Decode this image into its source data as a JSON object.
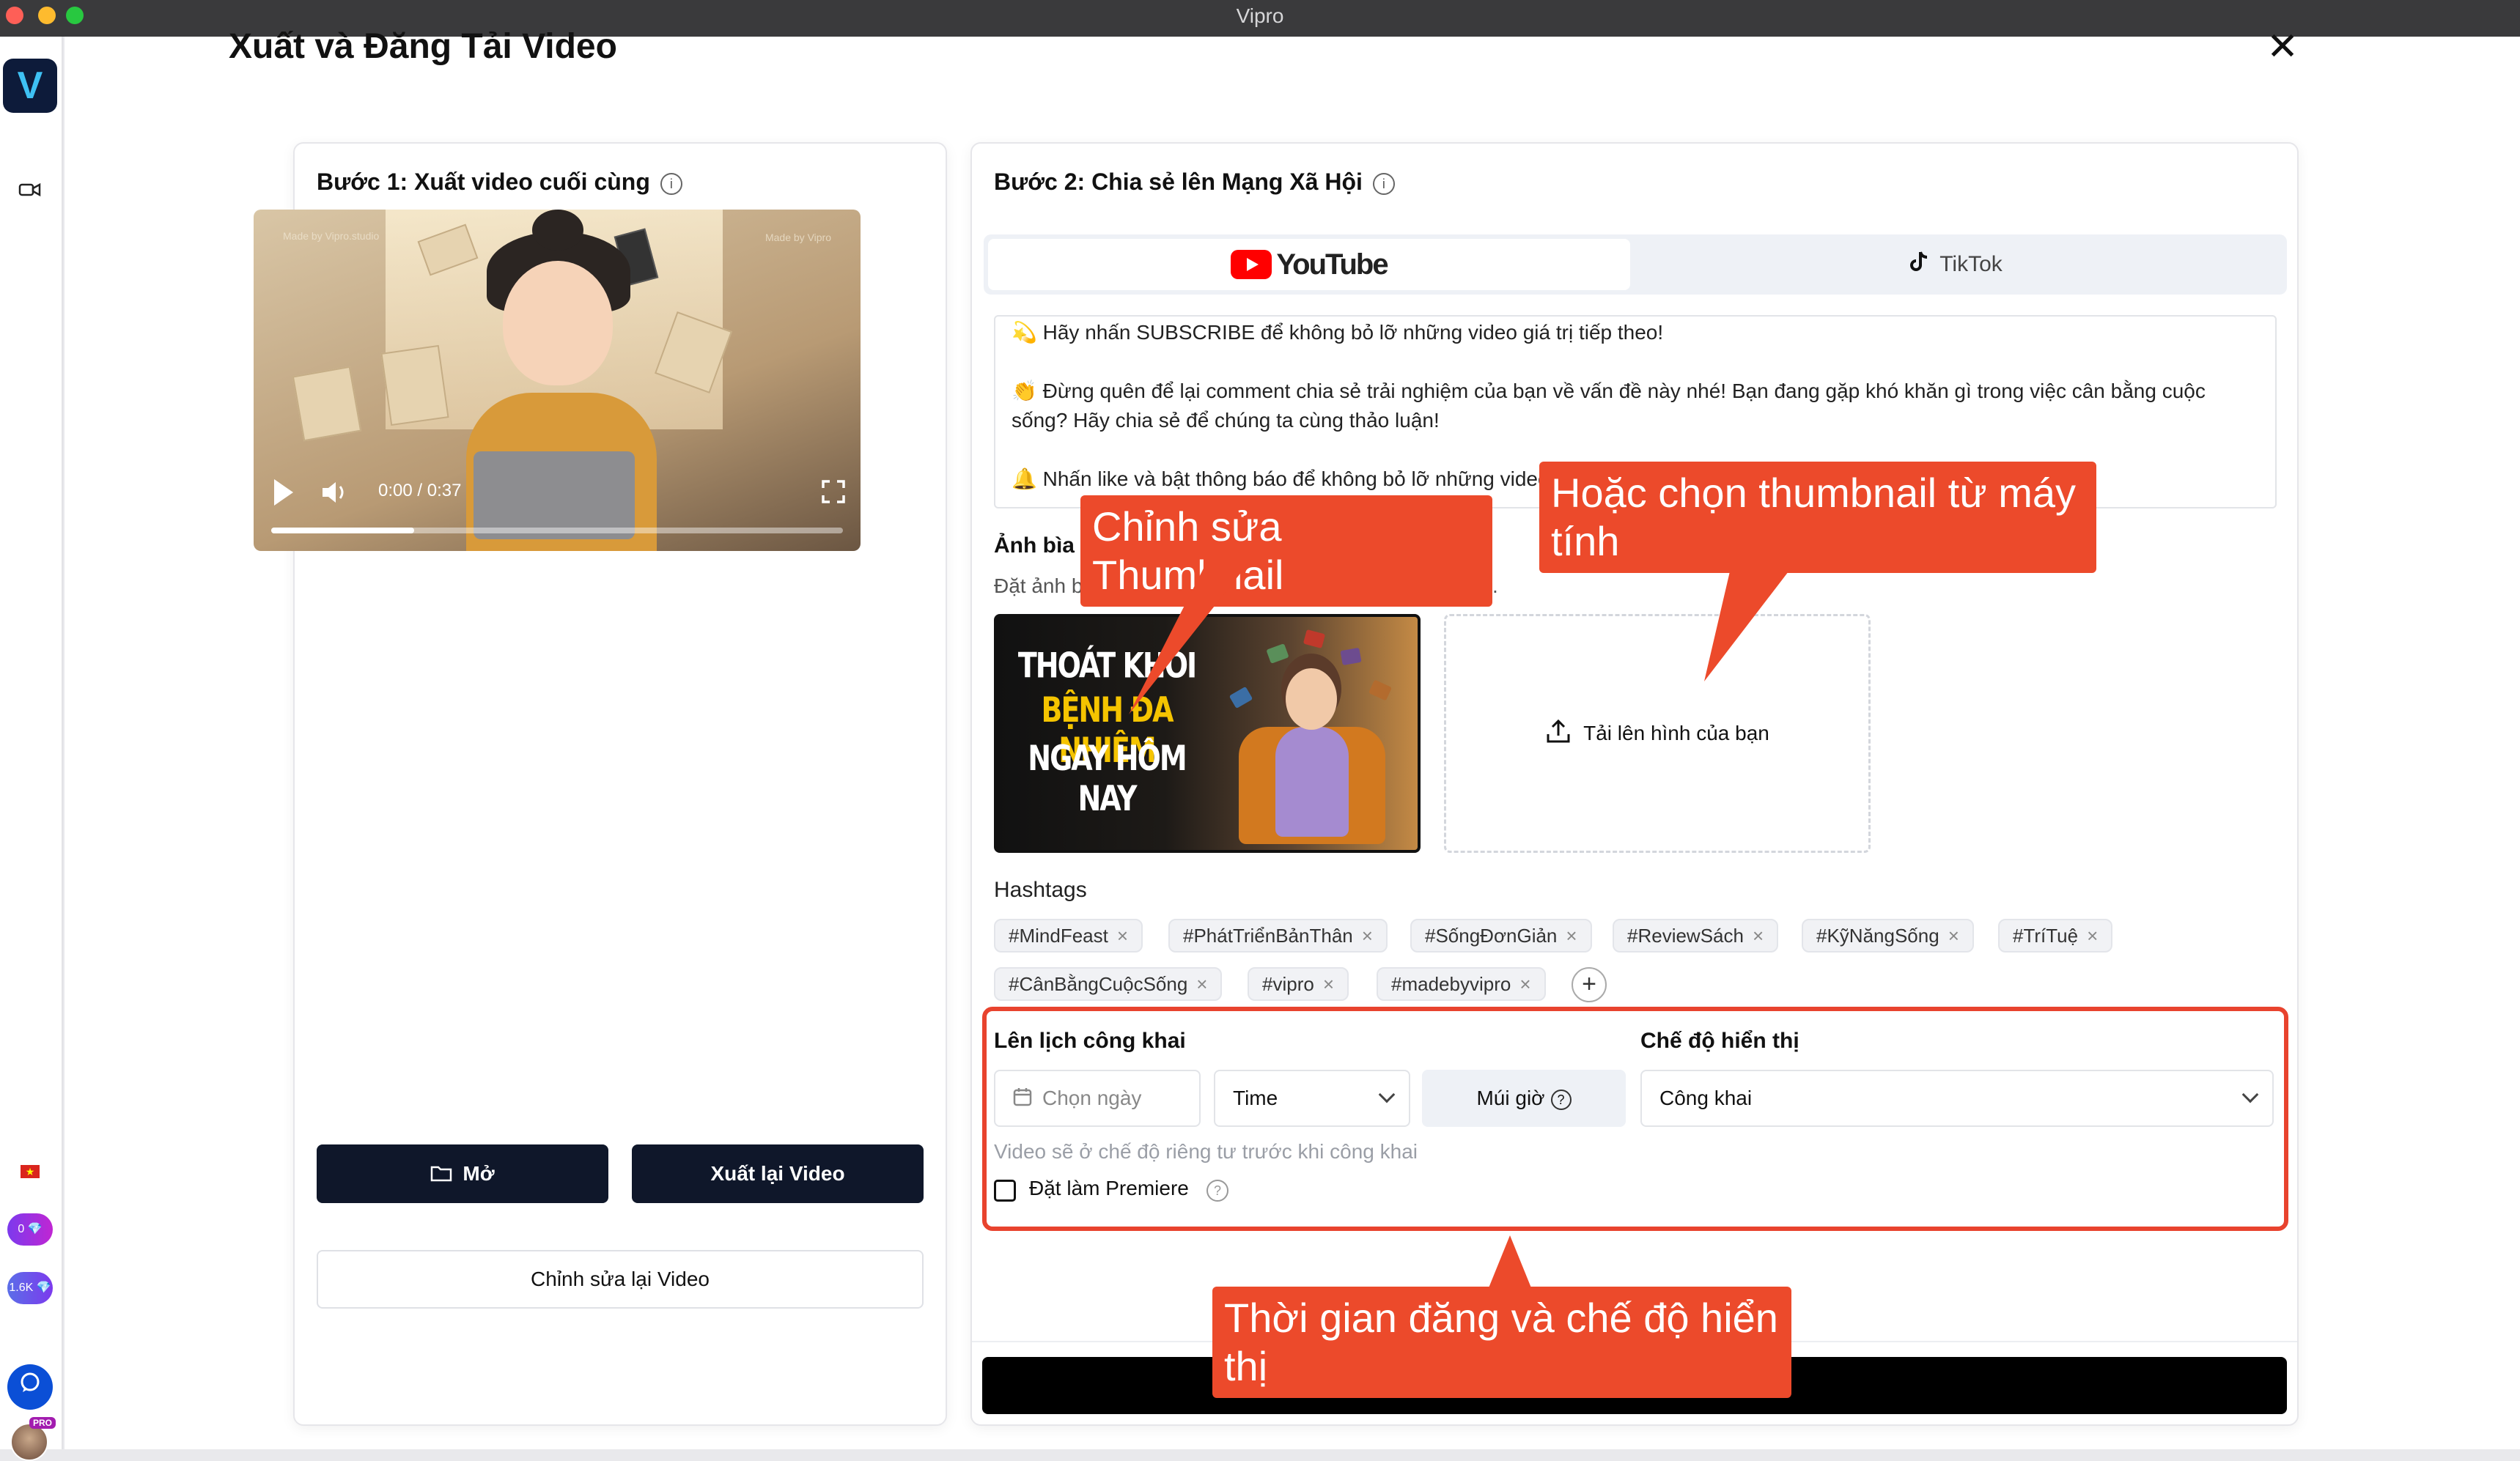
{
  "window": {
    "title": "Vipro"
  },
  "sidebar": {
    "logo_letter": "V",
    "pill_gems": "0 💎",
    "pill_followers": "1.6K 💎",
    "pro_badge": "PRO"
  },
  "page": {
    "title": "Xuất và Đăng Tải Video",
    "close_symbol": "✕"
  },
  "step1": {
    "title": "Bước 1: Xuất video cuối cùng",
    "video": {
      "watermark_left": "Made by Vipro.studio",
      "watermark_right": "Made by Vipro",
      "time": "0:00 / 0:37",
      "progress": 0.25
    },
    "open_button": "Mở",
    "reexport_button": "Xuất lại Video",
    "reedit_button": "Chỉnh sửa lại Video"
  },
  "step2": {
    "title": "Bước 2: Chia sẻ lên Mạng Xã Hội",
    "tabs": {
      "youtube": "YouTube",
      "tiktok": "TikTok",
      "active": "youtube"
    },
    "description": "💫 Hãy nhấn SUBSCRIBE để không bỏ lỡ những video giá trị tiếp theo!\n\n👏 Đừng quên để lại comment chia sẻ trải nghiệm của bạn về vấn đề này nhé! Bạn đang gặp khó khăn gì trong việc cân bằng cuộc sống? Hãy chia sẻ để chúng ta cùng thảo luận!\n\n🔔 Nhấn like và bật thông báo để không bỏ lỡ những video",
    "cover": {
      "label": "Ảnh bìa",
      "sub": "Đặt ảnh bìa nổi bật để thu hút sự chú ý của người xem.",
      "thumb_line1": "THOÁT KHỎI",
      "thumb_line2": "BỆNH ĐA NHIỆM",
      "thumb_line3": "NGAY HÔM NAY",
      "upload_label": "Tải lên hình của bạn"
    },
    "hashtags": {
      "label": "Hashtags",
      "items": [
        "#MindFeast",
        "#PhátTriểnBảnThân",
        "#SốngĐơnGiản",
        "#ReviewSách",
        "#KỹNăngSống",
        "#TríTuệ",
        "#CânBằngCuộcSống",
        "#vipro",
        "#madebyvipro"
      ],
      "add_symbol": "+"
    },
    "schedule": {
      "label": "Lên lịch công khai",
      "date_placeholder": "Chọn ngày",
      "time_value": "Time",
      "timezone_label": "Múi giờ",
      "visibility_label": "Chế độ hiển thị",
      "visibility_value": "Công khai",
      "hint": "Video sẽ ở chế độ riêng tư trước khi công khai",
      "premiere_label": "Đặt làm Premiere",
      "premiere_checked": false
    }
  },
  "callouts": {
    "edit_thumbnail": "Chỉnh sửa Thumbnail",
    "choose_from_computer": "Hoặc chọn thumbnail từ máy tính",
    "time_and_visibility": "Thời gian đăng và chế độ hiển thị"
  },
  "colors": {
    "accent_red": "#ec4a2b",
    "dark_button": "#0f172a",
    "youtube_red": "#ff0000"
  }
}
